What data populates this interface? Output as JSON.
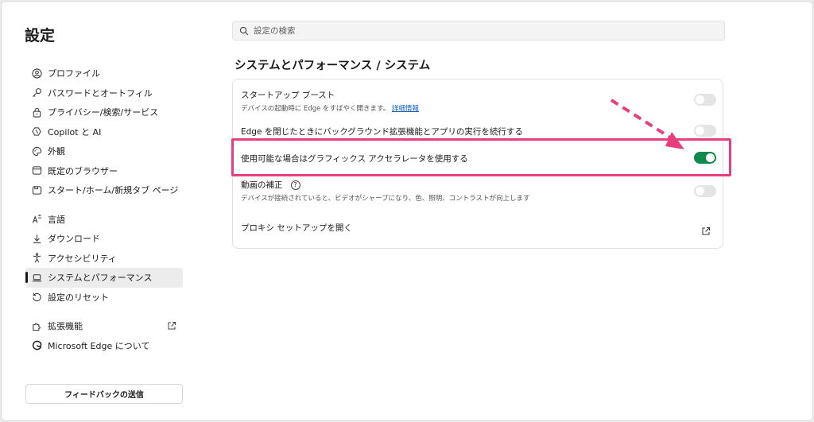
{
  "sidebar": {
    "title": "設定",
    "items": [
      {
        "label": "プロファイル"
      },
      {
        "label": "パスワードとオートフィル"
      },
      {
        "label": "プライバシー/検索/サービス"
      },
      {
        "label": "Copilot と AI"
      },
      {
        "label": "外観"
      },
      {
        "label": "既定のブラウザー"
      },
      {
        "label": "スタート/ホーム/新規タブ ページ"
      },
      {
        "label": "言語"
      },
      {
        "label": "ダウンロード"
      },
      {
        "label": "アクセシビリティ"
      },
      {
        "label": "システムとパフォーマンス"
      },
      {
        "label": "設定のリセット"
      },
      {
        "label": "拡張機能"
      },
      {
        "label": "Microsoft Edge について"
      }
    ],
    "feedback_label": "フィードバックの送信"
  },
  "search": {
    "placeholder": "設定の検索"
  },
  "main": {
    "title": "システムとパフォーマンス / システム",
    "settings": [
      {
        "title": "スタートアップ ブースト",
        "desc": "デバイスの起動時に Edge をすばやく開きます。",
        "link": "詳細情報",
        "enabled": false
      },
      {
        "title": "Edge を閉じたときにバックグラウンド拡張機能とアプリの実行を続行する",
        "enabled": false
      },
      {
        "title": "使用可能な場合はグラフィックス アクセラレータを使用する",
        "enabled": true
      },
      {
        "title": "動画の補正",
        "help": "?",
        "desc": "デバイスが接続されていると、ビデオがシャープになり、色、照明、コントラストが向上します",
        "enabled": false
      },
      {
        "title": "プロキシ セットアップを開く"
      }
    ]
  },
  "colors": {
    "accent_toggle": "#0e8a4a",
    "highlight": "#ea3d80"
  }
}
